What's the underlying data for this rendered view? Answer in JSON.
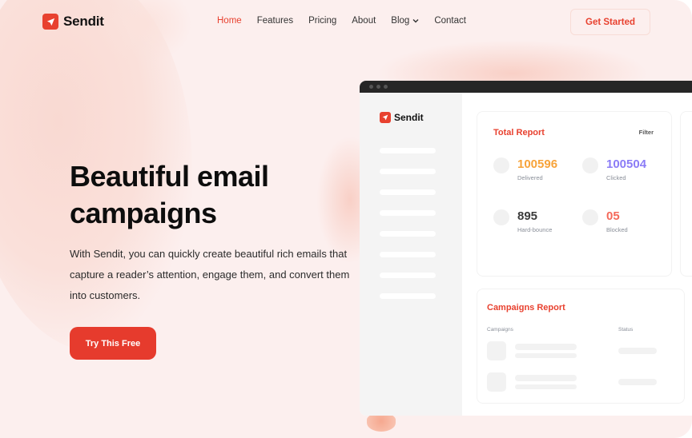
{
  "brand": {
    "name": "Sendit",
    "accent": "#e8412f",
    "logo_icon": "paper-plane-icon"
  },
  "nav": {
    "items": [
      {
        "label": "Home",
        "active": true
      },
      {
        "label": "Features"
      },
      {
        "label": "Pricing"
      },
      {
        "label": "About"
      },
      {
        "label": "Blog",
        "has_dropdown": true
      },
      {
        "label": "Contact"
      }
    ],
    "cta_label": "Get Started"
  },
  "hero": {
    "title_line1": "Beautiful email",
    "title_line2": "campaigns",
    "text": "With Sendit, you can quickly create beautiful rich emails that capture a reader’s attention, engage them, and convert them into customers.",
    "cta_label": "Try This Free"
  },
  "mockup": {
    "brand": "Sendit",
    "total_report": {
      "title": "Total Report",
      "filter_label": "Filter",
      "stats": [
        {
          "value": "100596",
          "label": "Delivered",
          "color": "#f7a33a"
        },
        {
          "value": "100504",
          "label": "Clicked",
          "color": "#8b7cf6"
        },
        {
          "value": "895",
          "label": "Hard-bounce",
          "color": "#3b3b3b"
        },
        {
          "value": "05",
          "label": "Blocked",
          "color": "#f4695a"
        }
      ]
    },
    "campaigns_report": {
      "title": "Campaigns Report",
      "columns": [
        "Campaigns",
        "Status"
      ]
    }
  }
}
